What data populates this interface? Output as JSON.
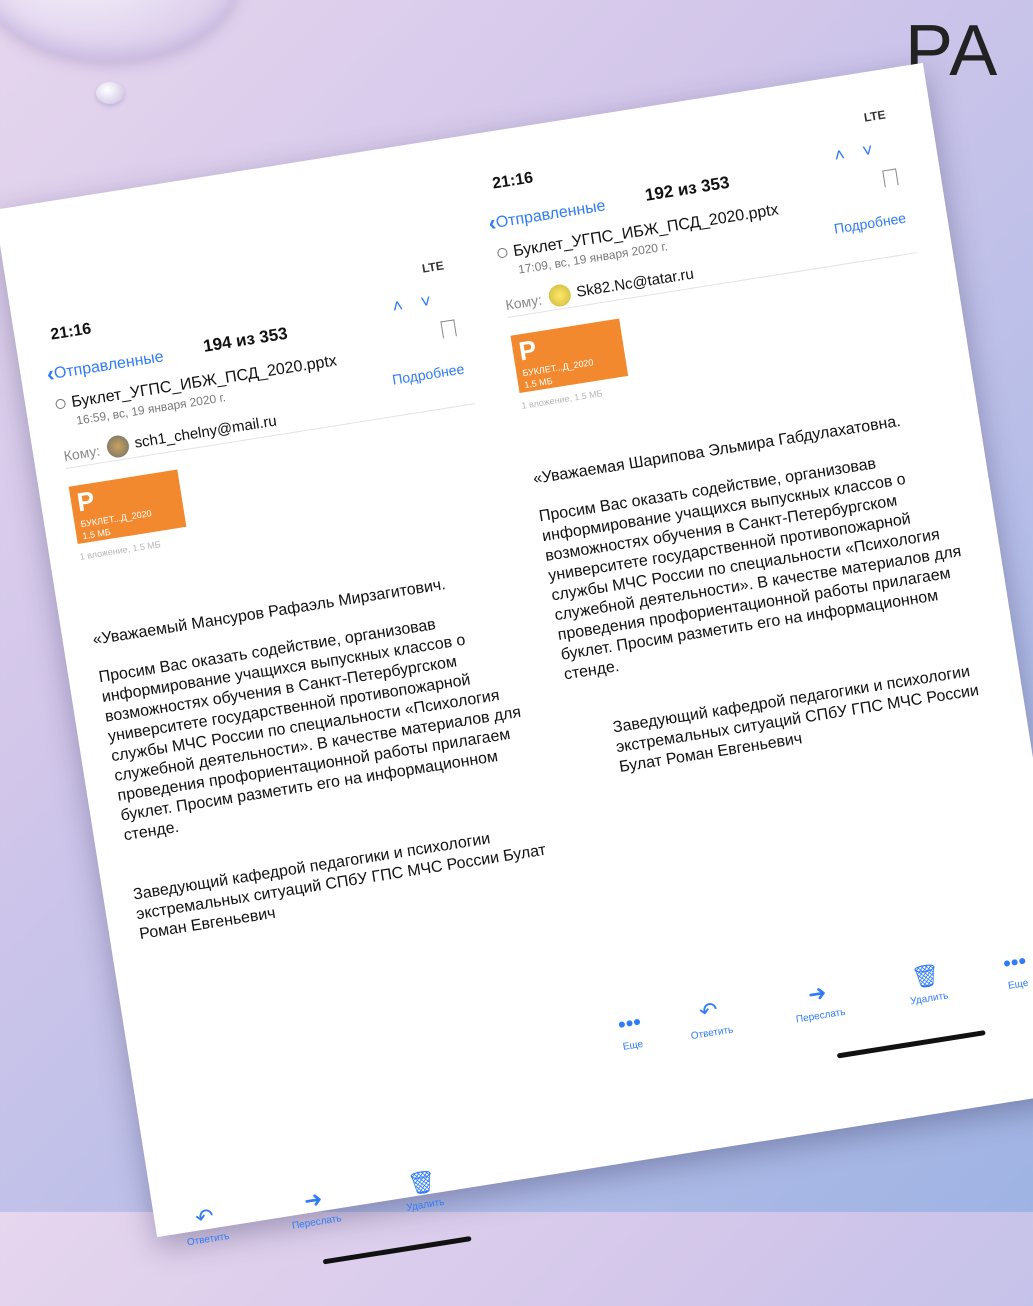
{
  "slide": {
    "title": "РА"
  },
  "phones": [
    {
      "time": "21:16",
      "signal": "LTE",
      "back_label": "Отправленные",
      "counter": "194 из 353",
      "subject": "Буклет_УГПС_ИБЖ_ПСД_2020.pptx",
      "date": "16:59, вс, 19 января 2020 г.",
      "to_label": "Кому:",
      "email": "sch1_chelny@mail.ru",
      "more_label": "Подробнее",
      "attachment": {
        "letter": "P",
        "name": "БУКЛЕТ...Д_2020",
        "size": "1.5 МБ",
        "caption": "1 вложение, 1.5 МБ"
      },
      "greeting": "«Уважаемый Мансуров Рафаэль Мирзагитович.",
      "body": "Просим Вас оказать содействие, организовав информирование учащихся выпускных классов о возможностях обучения в Санкт-Петербургском университете государственной противопожарной службы МЧС России по специальности «Психология служебной деятельности». В качестве материалов для проведения профориентационной работы прилагаем буклет. Просим разметить его на информационном стенде.",
      "signature": "Заведующий кафедрой педагогики и психологии экстремальных ситуаций СПбУ ГПС МЧС России Булат Роман Евгеньевич",
      "toolbar": {
        "reply": "Ответить",
        "forward": "Переслать",
        "delete": "Удалить"
      }
    },
    {
      "time": "21:16",
      "signal": "LTE",
      "back_label": "Отправленные",
      "counter": "192 из 353",
      "subject": "Буклет_УГПС_ИБЖ_ПСД_2020.pptx",
      "date": "17:09, вс, 19 января 2020 г.",
      "to_label": "Кому:",
      "email": "Sk82.Nc@tatar.ru",
      "more_label": "Подробнее",
      "attachment": {
        "letter": "P",
        "name": "БУКЛЕТ...Д_2020",
        "size": "1.5 МБ",
        "caption": "1 вложение, 1.5 МБ"
      },
      "greeting": "«Уважаемая Шарипова Эльмира Габдулахатовна.",
      "body": "Просим Вас оказать содействие, организовав информирование учащихся выпускных классов о возможностях обучения в Санкт-Петербургском университете государственной противопожарной службы МЧС России по специальности «Психология служебной деятельности». В качестве материалов для проведения профориентационной работы прилагаем буклет. Просим разметить его на информационном стенде.",
      "signature": "Заведующий кафедрой педагогики и психологии экстремальных ситуаций СПбУ ГПС МЧС России Булат Роман Евгеньевич",
      "toolbar": {
        "more": "Еще",
        "reply": "Ответить",
        "forward": "Переслать",
        "delete": "Удалить",
        "more2": "Еще"
      }
    }
  ]
}
